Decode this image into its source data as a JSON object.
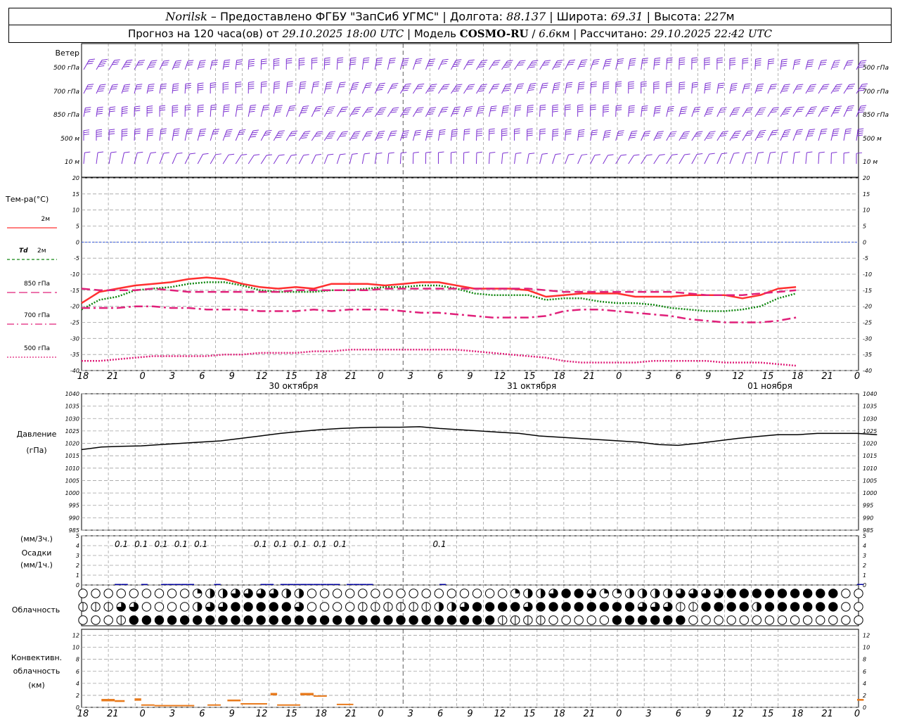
{
  "header": {
    "station": "Norilsk",
    "dash": "–",
    "provider": "Предоставлено ФГБУ \"ЗапСиб УГМС\"",
    "lon_label": "Долгота:",
    "lon_value": "88.137",
    "lat_label": "Широта:",
    "lat_value": "69.31",
    "alt_label": "Высота:",
    "alt_value": "227",
    "alt_unit": "м",
    "sep": "|",
    "forecast_prefix": "Прогноз на 120 часа(ов) от",
    "forecast_time": "29.10.2025 18:00 UTC",
    "model_label": "Модель",
    "model_name": "COSMO-RU",
    "model_res": "6.6",
    "model_res_unit": "км",
    "calc_label": "Рассчитано:",
    "calc_time": "29.10.2025 22:42 UTC"
  },
  "colors": {
    "wind": "#7b2fd1",
    "grid": "#a0a0a0",
    "t2m": "#ff3030",
    "td2m": "#118811",
    "t850": "#e0207a",
    "t700": "#e0207a",
    "t500": "#e0207a",
    "zero": "#3b5fe0",
    "pressure": "#000000",
    "precip": "#0000a0",
    "convective": "#e87a1c"
  },
  "time_axis": {
    "hour_labels": [
      "18",
      "21",
      "0",
      "3",
      "6",
      "9",
      "12",
      "15",
      "18",
      "21",
      "0",
      "3",
      "6",
      "9",
      "12",
      "15",
      "18",
      "21",
      "0",
      "3",
      "6",
      "9",
      "12",
      "15",
      "18",
      "21",
      "0"
    ],
    "day_labels": [
      "30 октября",
      "31 октября",
      "01 ноября"
    ]
  },
  "wind_panel": {
    "title": "Ветер",
    "levels": [
      "500 гПа",
      "700 гПа",
      "850 гПа",
      "500 м",
      "10 м"
    ],
    "levels_right": [
      "500 гПа",
      "700 гПа",
      "850 гПа",
      "500 м",
      "10 м"
    ]
  },
  "temp_panel": {
    "title": "Тем-ра(°C)",
    "legend": [
      {
        "prefix": "",
        "label": "2м",
        "style": "solid",
        "color": "#ff3030"
      },
      {
        "prefix": "Td",
        "label": "2м",
        "style": "dashed",
        "color": "#118811"
      },
      {
        "prefix": "",
        "label": "850 гПа",
        "style": "longdash",
        "color": "#e0207a"
      },
      {
        "prefix": "",
        "label": "700 гПа",
        "style": "dashdot",
        "color": "#e0207a"
      },
      {
        "prefix": "",
        "label": "500 гПа",
        "style": "dotted",
        "color": "#e0207a"
      }
    ]
  },
  "pressure_panel": {
    "title": "Давление",
    "unit": "(гПа)"
  },
  "precip_panel": {
    "line1": "(мм/3ч.)",
    "line2": "Осадки",
    "line3": "(мм/1ч.)"
  },
  "cloud_panel": {
    "title": "Облачность"
  },
  "conv_panel": {
    "line1": "Конвективн.",
    "line2": "облачность",
    "line3": "(км)"
  },
  "chart_data": [
    {
      "type": "line",
      "title": "Тем-ра(°C)",
      "x_hours": [
        0,
        3,
        6,
        9,
        12,
        15,
        18,
        21,
        24,
        27,
        30,
        33,
        36,
        39,
        42,
        45,
        48,
        51,
        54,
        57,
        60,
        63,
        66,
        69,
        72,
        75,
        78,
        81,
        84,
        87,
        90,
        93,
        96,
        99,
        102,
        105,
        108,
        111,
        114,
        117,
        120
      ],
      "ylim": [
        -40,
        20
      ],
      "yticks": [
        20,
        15,
        10,
        5,
        0,
        -5,
        -10,
        -15,
        -20,
        -25,
        -30,
        -35,
        -40
      ],
      "series": [
        {
          "name": "2м",
          "values": [
            -19,
            -15.5,
            -14.5,
            -13.5,
            -13,
            -12.5,
            -11.5,
            -11,
            -11.5,
            -13,
            -14,
            -14.5,
            -14,
            -14.5,
            -13,
            -13,
            -13,
            -13.5,
            -13,
            -12.5,
            -12.5,
            -13.5,
            -14.5,
            -14.5,
            -14.5,
            -15,
            -17,
            -16.5,
            -16,
            -16,
            -16,
            -17,
            -17,
            -17,
            -16.5,
            -16.5,
            -16.5,
            -17.5,
            -16.5,
            -14.5,
            -14
          ]
        },
        {
          "name": "Td 2м",
          "values": [
            -21,
            -18,
            -17,
            -15,
            -14.5,
            -14,
            -13,
            -12.5,
            -12.5,
            -13.5,
            -15,
            -15.5,
            -15.5,
            -15.5,
            -15,
            -15,
            -14.5,
            -14,
            -14,
            -13.5,
            -13.5,
            -14.5,
            -16,
            -16.5,
            -16.5,
            -16.5,
            -18,
            -17.5,
            -17.5,
            -18.5,
            -19,
            -19,
            -19.5,
            -20.5,
            -21,
            -21.5,
            -21.5,
            -21,
            -20,
            -17.5,
            -16
          ]
        },
        {
          "name": "850 гПа",
          "values": [
            -14.5,
            -15,
            -15,
            -15,
            -14.5,
            -15,
            -15.5,
            -15.5,
            -15.5,
            -15.5,
            -15.5,
            -15.5,
            -15,
            -15,
            -15,
            -15,
            -15,
            -14.5,
            -14.5,
            -14.5,
            -14.5,
            -14.5,
            -14.5,
            -14.5,
            -14.5,
            -14.5,
            -15,
            -15.5,
            -15.5,
            -15.5,
            -15.5,
            -15.5,
            -15.5,
            -15.5,
            -16,
            -16.5,
            -16.5,
            -16.5,
            -16,
            -15.5,
            -15
          ]
        },
        {
          "name": "700 гПа",
          "values": [
            -20.5,
            -20.5,
            -20.5,
            -20,
            -20,
            -20.5,
            -20.5,
            -21,
            -21,
            -21,
            -21.5,
            -21.5,
            -21.5,
            -21,
            -21.5,
            -21,
            -21,
            -21,
            -21.5,
            -22,
            -22,
            -22.5,
            -23,
            -23.5,
            -23.5,
            -23.5,
            -23,
            -21.5,
            -21,
            -21,
            -21.5,
            -22,
            -22.5,
            -23,
            -24,
            -24.5,
            -25,
            -25,
            -25,
            -24.5,
            -23.5
          ]
        },
        {
          "name": "500 гПа",
          "values": [
            -37,
            -37,
            -36.5,
            -36,
            -35.5,
            -35.5,
            -35.5,
            -35.5,
            -35,
            -35,
            -34.5,
            -34.5,
            -34.5,
            -34,
            -34,
            -33.5,
            -33.5,
            -33.5,
            -33.5,
            -33.5,
            -33.5,
            -33.5,
            -34,
            -34.5,
            -35,
            -35.5,
            -36,
            -37,
            -37.5,
            -37.5,
            -37.5,
            -37.5,
            -37,
            -37,
            -37,
            -37,
            -37.5,
            -37.5,
            -37.5,
            -38,
            -38.5
          ]
        }
      ]
    },
    {
      "type": "line",
      "title": "Давление",
      "ylabel": "(гПа)",
      "x_hours": [
        0,
        3,
        6,
        9,
        12,
        15,
        18,
        21,
        24,
        27,
        30,
        33,
        36,
        39,
        42,
        45,
        48,
        51,
        54,
        57,
        60,
        63,
        66,
        69,
        72,
        75,
        78,
        81,
        84,
        87,
        90,
        93,
        96,
        99,
        102,
        105,
        108,
        111,
        114,
        117,
        120
      ],
      "ylim": [
        985,
        1040
      ],
      "yticks": [
        1040,
        1035,
        1030,
        1025,
        1020,
        1015,
        1010,
        1005,
        1000,
        995,
        990,
        985
      ],
      "series": [
        {
          "name": "",
          "values": [
            1017.5,
            1018.5,
            1018.8,
            1019,
            1019.5,
            1020,
            1020.5,
            1021,
            1022,
            1023,
            1024,
            1024.8,
            1025.5,
            1026,
            1026.3,
            1026.5,
            1026.5,
            1026.7,
            1026,
            1025.5,
            1025,
            1024.5,
            1024,
            1023,
            1022.5,
            1022,
            1021.5,
            1021,
            1020.5,
            1019.5,
            1019.2,
            1020,
            1021,
            1022,
            1022.8,
            1023.5,
            1023.5,
            1024,
            1024,
            1024,
            1023.5
          ]
        }
      ]
    },
    {
      "type": "bar",
      "title": "Осадки",
      "ylabel": "(мм/3ч.) (мм/1ч.)",
      "ylim": [
        0,
        5
      ],
      "yticks": [
        5,
        4,
        3,
        2,
        1,
        0
      ],
      "labels_3h": [
        {
          "hour": 6,
          "value": "0.1"
        },
        {
          "hour": 9,
          "value": "0.1"
        },
        {
          "hour": 12,
          "value": "0.1"
        },
        {
          "hour": 15,
          "value": "0.1"
        },
        {
          "hour": 18,
          "value": "0.1"
        },
        {
          "hour": 27,
          "value": "0.1"
        },
        {
          "hour": 30,
          "value": "0.1"
        },
        {
          "hour": 33,
          "value": "0.1"
        },
        {
          "hour": 36,
          "value": "0.1"
        },
        {
          "hour": 39,
          "value": "0.1"
        },
        {
          "hour": 54,
          "value": "0.1"
        }
      ],
      "hourly_values": [
        0,
        0,
        0,
        0,
        0,
        0.1,
        0.1,
        0,
        0,
        0.1,
        0,
        0,
        0.1,
        0.1,
        0.1,
        0.1,
        0.1,
        0,
        0,
        0,
        0.1,
        0,
        0,
        0,
        0,
        0,
        0,
        0.1,
        0.1,
        0,
        0.1,
        0.1,
        0.1,
        0.1,
        0.1,
        0.1,
        0.1,
        0.1,
        0.1,
        0,
        0.1,
        0.1,
        0.1,
        0.1,
        0,
        0,
        0,
        0,
        0,
        0,
        0,
        0,
        0,
        0,
        0.1,
        0,
        0,
        0,
        0,
        0,
        0,
        0,
        0,
        0,
        0,
        0,
        0,
        0,
        0,
        0,
        0,
        0,
        0,
        0,
        0,
        0,
        0,
        0,
        0,
        0,
        0,
        0,
        0,
        0,
        0,
        0,
        0,
        0,
        0,
        0,
        0,
        0,
        0,
        0,
        0,
        0,
        0,
        0,
        0,
        0,
        0,
        0,
        0,
        0,
        0,
        0,
        0,
        0,
        0,
        0,
        0,
        0,
        0,
        0,
        0,
        0,
        0,
        0.1,
        0,
        0
      ]
    },
    {
      "type": "heatmap",
      "title": "Облачность",
      "note": "cloud cover per 2h step (0=clear, 1=¼, 2=½, 3=¾, 4=overcast, 5=obscured) for upper/middle/low rows",
      "rows": [
        {
          "name": "upper",
          "values": [
            0,
            0,
            0,
            0,
            0,
            0,
            0,
            0,
            0,
            1,
            2,
            2,
            3,
            3,
            3,
            3,
            2,
            2,
            0,
            0,
            0,
            0,
            0,
            0,
            0,
            0,
            0,
            0,
            0,
            0,
            0,
            0,
            0,
            0,
            1,
            2,
            2,
            3,
            4,
            4,
            3,
            1,
            1,
            2,
            2,
            2,
            2,
            3,
            3,
            3,
            3,
            4,
            4,
            4,
            4,
            4,
            4,
            4,
            4,
            4,
            0,
            0
          ]
        },
        {
          "name": "middle",
          "values": [
            5,
            5,
            5,
            3,
            3,
            0,
            0,
            0,
            0,
            2,
            3,
            3,
            4,
            4,
            4,
            4,
            4,
            3,
            0,
            0,
            0,
            0,
            5,
            5,
            5,
            5,
            5,
            5,
            2,
            2,
            3,
            4,
            4,
            4,
            4,
            3,
            4,
            4,
            4,
            4,
            4,
            4,
            4,
            4,
            3,
            3,
            3,
            5,
            5,
            4,
            4,
            4,
            4,
            2,
            4,
            4,
            4,
            4,
            4,
            4,
            0,
            0
          ]
        },
        {
          "name": "low",
          "values": [
            0,
            0,
            0,
            5,
            4,
            4,
            4,
            4,
            4,
            4,
            4,
            4,
            4,
            4,
            4,
            4,
            4,
            4,
            4,
            4,
            4,
            4,
            4,
            4,
            4,
            4,
            4,
            4,
            4,
            4,
            4,
            4,
            4,
            5,
            5,
            5,
            5,
            0,
            0,
            0,
            0,
            0,
            4,
            4,
            4,
            4,
            4,
            4,
            0,
            0,
            0,
            0,
            0,
            0,
            0,
            0,
            0,
            0,
            0,
            0,
            0,
            0
          ]
        }
      ]
    },
    {
      "type": "bar",
      "title": "Конвективн. облачность (км)",
      "ylim": [
        0,
        13
      ],
      "yticks": [
        12,
        10,
        8,
        6,
        4,
        2,
        0
      ],
      "segments": [
        {
          "start": 3,
          "end": 5,
          "base": 1.0,
          "top": 1.4
        },
        {
          "start": 5,
          "end": 6.5,
          "base": 0.9,
          "top": 1.2
        },
        {
          "start": 8,
          "end": 9,
          "base": 1.1,
          "top": 1.5
        },
        {
          "start": 9,
          "end": 11,
          "base": 0.3,
          "top": 0.5
        },
        {
          "start": 11,
          "end": 17,
          "base": 0.3,
          "top": 0.4
        },
        {
          "start": 19,
          "end": 21,
          "base": 0.3,
          "top": 0.5
        },
        {
          "start": 22,
          "end": 24,
          "base": 1.0,
          "top": 1.3
        },
        {
          "start": 24,
          "end": 28,
          "base": 0.5,
          "top": 0.7
        },
        {
          "start": 28.5,
          "end": 29.5,
          "base": 2.0,
          "top": 2.4
        },
        {
          "start": 29.5,
          "end": 33,
          "base": 0.3,
          "top": 0.5
        },
        {
          "start": 33,
          "end": 35,
          "base": 2.0,
          "top": 2.4
        },
        {
          "start": 35,
          "end": 37,
          "base": 1.8,
          "top": 2.0
        },
        {
          "start": 38.5,
          "end": 41,
          "base": 0.4,
          "top": 0.6
        },
        {
          "start": 117,
          "end": 118,
          "base": 1.1,
          "top": 1.4
        }
      ]
    }
  ]
}
